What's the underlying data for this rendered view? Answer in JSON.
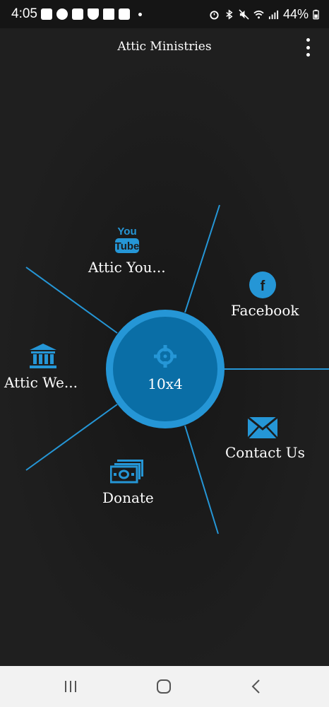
{
  "status_bar": {
    "time": "4:05",
    "battery": "44%"
  },
  "app_bar": {
    "title": "Attic Ministries"
  },
  "radial_menu": {
    "center": {
      "label": "10x4",
      "icon": "crosshair-icon"
    },
    "items": [
      {
        "label": "Attic You...",
        "icon": "youtube-icon"
      },
      {
        "label": "Facebook",
        "icon": "facebook-icon"
      },
      {
        "label": "Attic We...",
        "icon": "bank-icon"
      },
      {
        "label": "Contact Us",
        "icon": "envelope-icon"
      },
      {
        "label": "Donate",
        "icon": "money-icon"
      }
    ]
  },
  "colors": {
    "accent": "#2596d6",
    "hub_inner": "#0a6ea6",
    "background": "#1c1c1c",
    "nav_bar": "#f2f2f2"
  }
}
